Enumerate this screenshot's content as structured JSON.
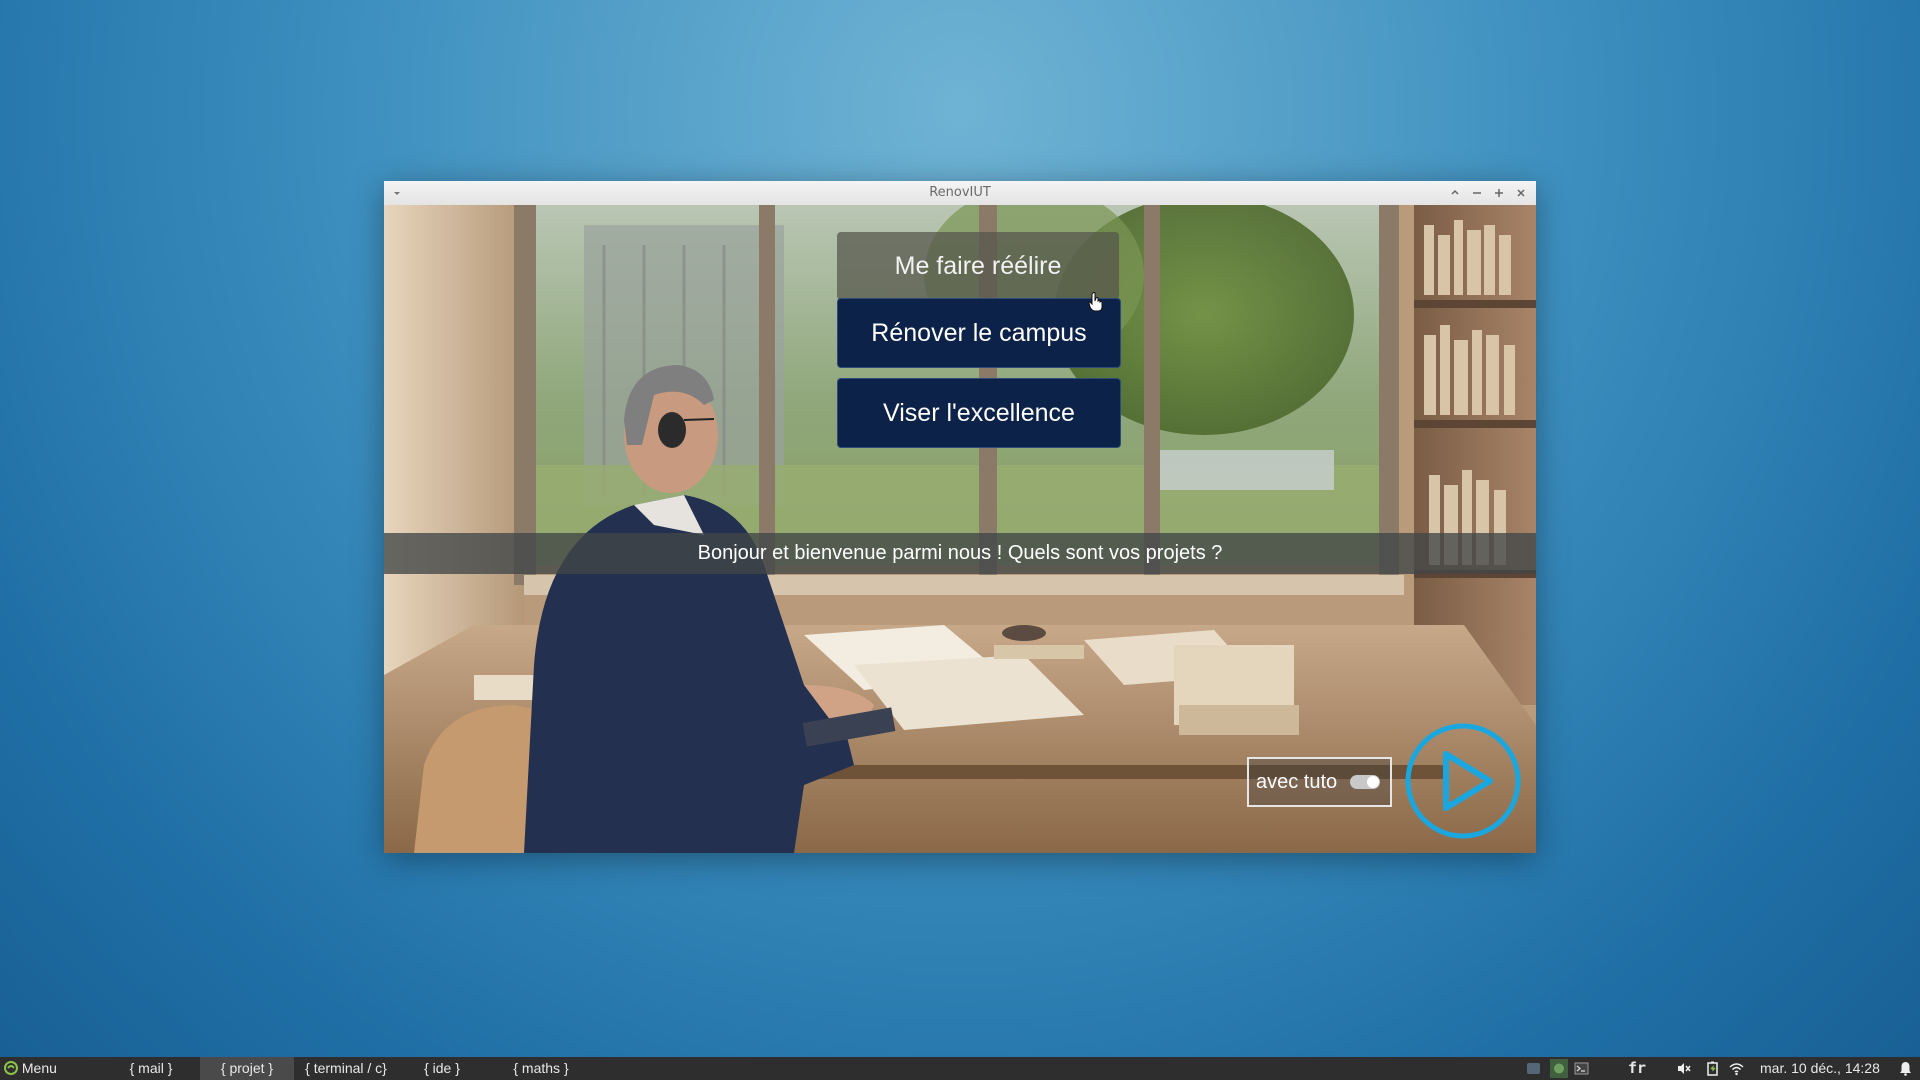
{
  "window": {
    "title": "RenovIUT"
  },
  "choices": [
    {
      "label": "Me faire réélire"
    },
    {
      "label": "Rénover le campus"
    },
    {
      "label": "Viser l'excellence"
    }
  ],
  "dialogue": {
    "text": "Bonjour et bienvenue parmi nous ! Quels sont vos projets ?"
  },
  "tuto": {
    "label": "avec tuto",
    "enabled": true
  },
  "play": {
    "icon": "play-icon"
  },
  "taskbar": {
    "menu_label": "Menu",
    "workspaces": [
      "{ mail }",
      "{ projet }",
      "{ terminal / c}",
      "{ ide }",
      "{ maths }"
    ],
    "active_workspace": "{ projet }",
    "keyboard_layout": "fr",
    "clock": "mar. 10 déc., 14:28"
  },
  "colors": {
    "choice_dark": "#0c2248",
    "play_ring": "#1aa7e0",
    "desktop": "#3d8fbf",
    "taskbar": "#2e2e2e"
  }
}
